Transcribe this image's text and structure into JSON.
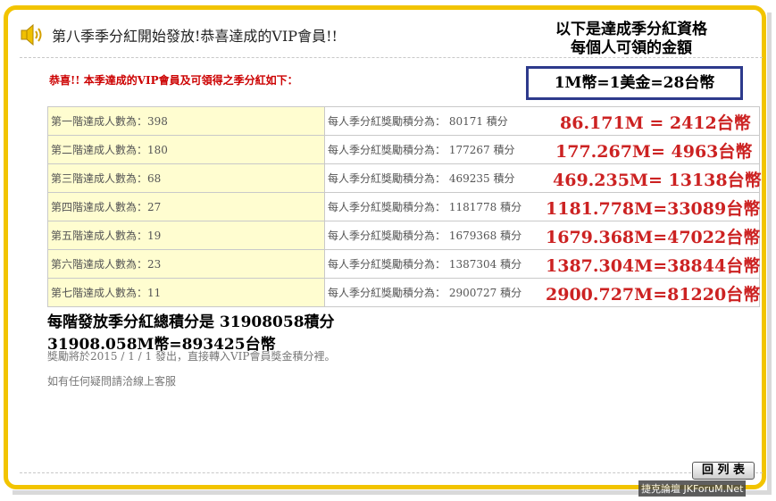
{
  "header": {
    "title": "第八季季分紅開始發放!恭喜達成的VIP會員!!",
    "note_line1": "以下是達成季分紅資格",
    "note_line2": "每個人可領的金額",
    "rate": "1M幣=1美金=28台幣"
  },
  "congrats": "恭喜!! 本季達成的VIP會員及可領得之季分紅如下：",
  "rows": [
    {
      "level": "第一階達成人數為：398",
      "points": "每人季分紅獎勵積分為： 80171 積分",
      "value": "86.171M = 2412台幣"
    },
    {
      "level": "第二階達成人數為：180",
      "points": "每人季分紅獎勵積分為： 177267 積分",
      "value": "177.267M= 4963台幣"
    },
    {
      "level": "第三階達成人數為：68",
      "points": "每人季分紅獎勵積分為： 469235 積分",
      "value": "469.235M= 13138台幣"
    },
    {
      "level": "第四階達成人數為：27",
      "points": "每人季分紅獎勵積分為： 1181778 積分",
      "value": "1181.778M=33089台幣"
    },
    {
      "level": "第五階達成人數為：19",
      "points": "每人季分紅獎勵積分為： 1679368 積分",
      "value": "1679.368M=47022台幣"
    },
    {
      "level": "第六階達成人數為：23",
      "points": "每人季分紅獎勵積分為： 1387304 積分",
      "value": "1387.304M=38844台幣"
    },
    {
      "level": "第七階達成人數為：11",
      "points": "每人季分紅獎勵積分為： 2900727 積分",
      "value": "2900.727M=81220台幣"
    }
  ],
  "totals": {
    "line1": "每階發放季分紅總積分是 31908058積分",
    "line2": "31908.058M幣=893425台幣"
  },
  "footer": {
    "notice": "獎勵將於2015 / 1 / 1 發出，直接轉入VIP會員獎金積分裡。",
    "contact": "如有任何疑問請洽線上客服",
    "back_label": "回 列 表"
  },
  "watermark": "捷克論壇 JKForuM.Net",
  "colors": {
    "frame": "#f2c400",
    "accent_red": "#cc2222",
    "box_border": "#2d3a8c",
    "row_bg": "#fffdd0"
  }
}
